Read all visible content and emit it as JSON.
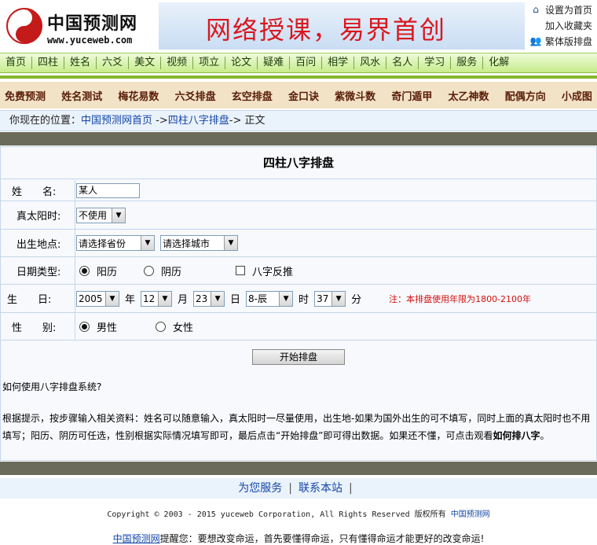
{
  "header": {
    "logo_cn": "中国预测网",
    "logo_url": "www.yuceweb.com",
    "banner_text": "网络授课，易界首创",
    "links": [
      {
        "label": "设置为首页",
        "icon": "house-icon"
      },
      {
        "label": "加入收藏夹",
        "icon": ""
      },
      {
        "label": "繁体版排盘",
        "icon": "users-icon"
      }
    ]
  },
  "nav1": [
    "首页",
    "四柱",
    "姓名",
    "六爻",
    "美文",
    "视频",
    "项立",
    "论文",
    "疑难",
    "百问",
    "相学",
    "风水",
    "名人",
    "学习",
    "服务",
    "化解"
  ],
  "nav2": [
    "免费预测",
    "姓名测试",
    "梅花易数",
    "六爻排盘",
    "玄空排盘",
    "金口诀",
    "紫微斗数",
    "奇门遁甲",
    "太乙神数",
    "配偶方向",
    "小成图"
  ],
  "breadcrumb": {
    "prefix": "你现在的位置：",
    "home": "中国预测网首页",
    "sep1": " ->",
    "section": "四柱八字排盘",
    "sep2": "-> ",
    "current": "正文"
  },
  "form": {
    "title": "四柱八字排盘",
    "name_label": "姓　　名:",
    "name_value": "某人",
    "solar_label": "真太阳时:",
    "solar_value": "不使用",
    "place_label": "出生地点:",
    "province_value": "请选择省份",
    "city_value": "请选择城市",
    "datetype_label": "日期类型:",
    "datetype_options": [
      "阳历",
      "阴历",
      "八字反推"
    ],
    "birth_label": "生　　日:",
    "year": "2005",
    "year_unit": "年",
    "month": "12",
    "month_unit": "月",
    "day": "23",
    "day_unit": "日",
    "hour": "8-辰",
    "hour_unit": "时",
    "minute": "37",
    "minute_unit": "分",
    "note": "注：本排盘使用年限为1800-2100年",
    "gender_label": "性　　别:",
    "gender_options": [
      "男性",
      "女性"
    ],
    "submit": "开始排盘"
  },
  "help": {
    "question": "如何使用八字排盘系统?",
    "text": "根据提示，按步骤输入相关资料：姓名可以随意输入，真太阳时一尽量使用，出生地-如果为国外出生的可不填写，同时上面的真太阳时也不用填写；阳历、阴历可任选，性别根据实际情况填写即可，最后点击“开始排盘”即可得出数据。如果还不懂，可点击观看",
    "link": "如何排八字",
    "end": "。"
  },
  "footer": {
    "service": "为您服务",
    "contact": "联系本站",
    "sep": "|",
    "copyright": "Copyright © 2003 - 2015 yuceweb Corporation, All Rights Reserved",
    "rights_cn": "版权所有",
    "site_name": "中国预测网",
    "tip_site": "中国预测网",
    "tip_text": "提醒您：要想改变命运，首先要懂得命运，只有懂得命运才能更好的改变命运!"
  }
}
